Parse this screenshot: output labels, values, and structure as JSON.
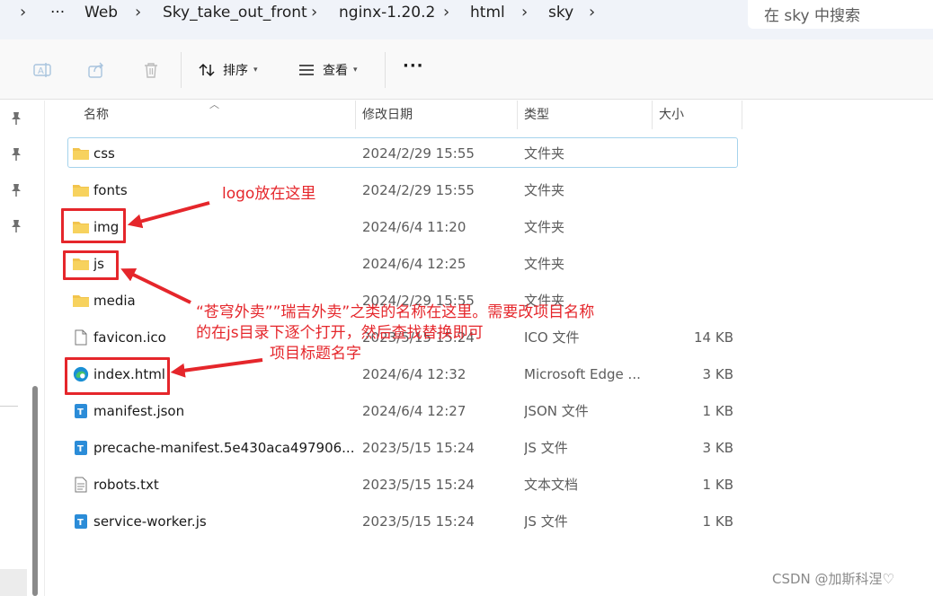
{
  "breadcrumb": {
    "more": "···",
    "items": [
      "Web",
      "Sky_take_out_front",
      "nginx-1.20.2",
      "html",
      "sky"
    ]
  },
  "search": {
    "placeholder": "在 sky 中搜索"
  },
  "toolbar": {
    "sort_label": "排序",
    "view_label": "查看",
    "more_label": "···"
  },
  "columns": {
    "name": "名称",
    "date": "修改日期",
    "type": "类型",
    "size": "大小"
  },
  "files": [
    {
      "name": "css",
      "date": "2024/2/29 15:55",
      "type": "文件夹",
      "size": "",
      "icon": "folder"
    },
    {
      "name": "fonts",
      "date": "2024/2/29 15:55",
      "type": "文件夹",
      "size": "",
      "icon": "folder"
    },
    {
      "name": "img",
      "date": "2024/6/4 11:20",
      "type": "文件夹",
      "size": "",
      "icon": "folder"
    },
    {
      "name": "js",
      "date": "2024/6/4 12:25",
      "type": "文件夹",
      "size": "",
      "icon": "folder"
    },
    {
      "name": "media",
      "date": "2024/2/29 15:55",
      "type": "文件夹",
      "size": "",
      "icon": "folder"
    },
    {
      "name": "favicon.ico",
      "date": "2023/5/15 15:24",
      "type": "ICO 文件",
      "size": "14 KB",
      "icon": "file"
    },
    {
      "name": "index.html",
      "date": "2024/6/4 12:32",
      "type": "Microsoft Edge ...",
      "size": "3 KB",
      "icon": "edge"
    },
    {
      "name": "manifest.json",
      "date": "2024/6/4 12:27",
      "type": "JSON 文件",
      "size": "1 KB",
      "icon": "code"
    },
    {
      "name": "precache-manifest.5e430aca497906...",
      "date": "2023/5/15 15:24",
      "type": "JS 文件",
      "size": "3 KB",
      "icon": "code"
    },
    {
      "name": "robots.txt",
      "date": "2023/5/15 15:24",
      "type": "文本文档",
      "size": "1 KB",
      "icon": "text"
    },
    {
      "name": "service-worker.js",
      "date": "2023/5/15 15:24",
      "type": "JS 文件",
      "size": "1 KB",
      "icon": "code"
    }
  ],
  "annotations": {
    "logo": "logo放在这里",
    "js_line1": "“苍穹外卖””瑞吉外卖”之类的名称在这里。需要改项目名称",
    "js_line2": "的在js目录下逐个打开，然后查找替换即可",
    "index": "项目标题名字"
  },
  "watermark": "CSDN @加斯科涅♡",
  "colors": {
    "annotation": "#e5262b",
    "folder": "#f2c44d",
    "edge": "#1a8fd4",
    "selection": "#a5d3ec"
  }
}
